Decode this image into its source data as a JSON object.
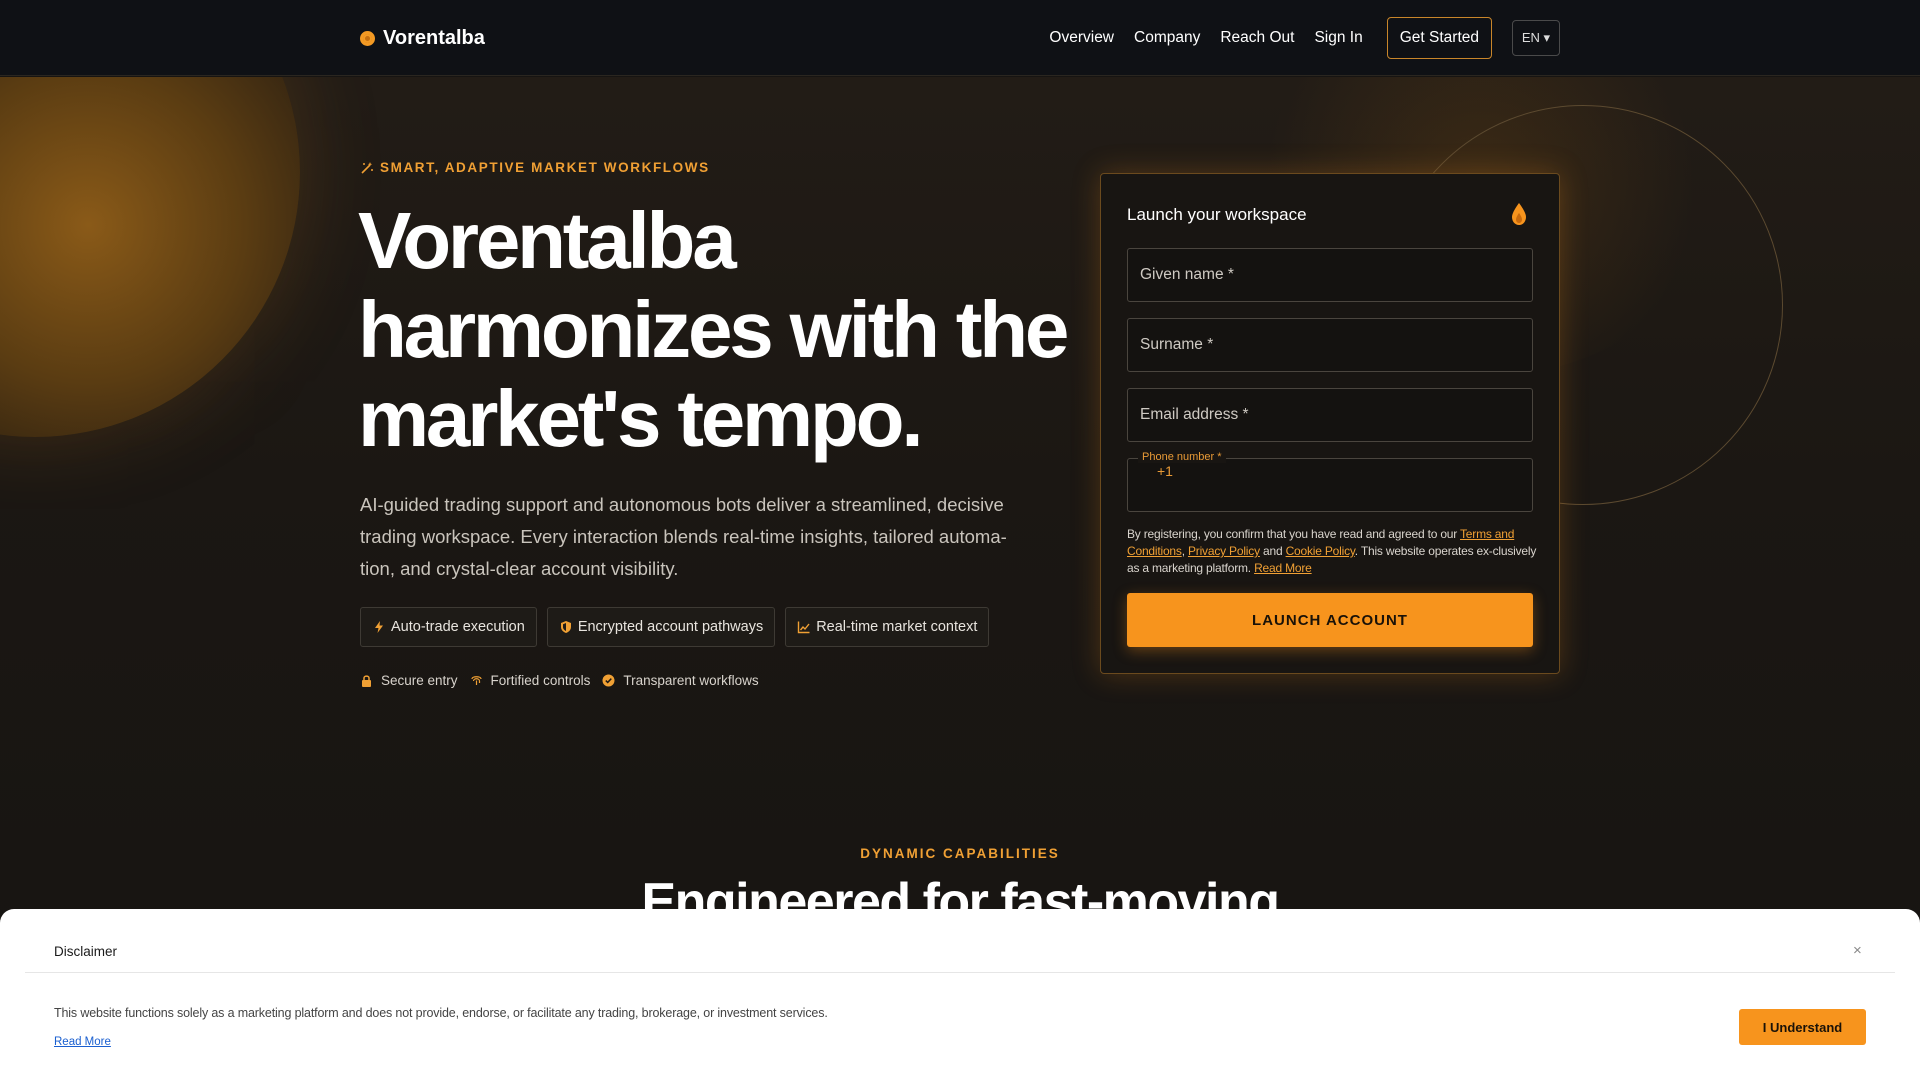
{
  "header": {
    "brand": "Vorentalba",
    "nav": [
      "Overview",
      "Company",
      "Reach Out",
      "Sign In"
    ],
    "cta": "Get Started",
    "lang": "EN ▾"
  },
  "hero": {
    "eyebrow": "SMART, ADAPTIVE MARKET WORKFLOWS",
    "title_line1": "Vorentalba",
    "title_line2": "harmonizes with the",
    "title_line3": "market's tempo.",
    "subtitle": "AI-guided trading support and autonomous bots deliver a streamlined, decisive trading workspace. Every interaction blends real-time insights, tailored automa-tion, and crystal-clear account visibility.",
    "chips": [
      "Auto-trade execution",
      "Encrypted account pathways",
      "Real-time market context"
    ],
    "trust": [
      "Secure entry",
      "Fortified controls",
      "Transparent workflows"
    ]
  },
  "form": {
    "title": "Launch your workspace",
    "given_name": "Given name *",
    "surname": "Surname *",
    "email": "Email address *",
    "phone_label": "Phone number *",
    "phone_code": "+1",
    "legal_pre": "By registering, you confirm that you have read and agreed to our ",
    "terms": "Terms and Conditions",
    "privacy": "Privacy Policy",
    "and": " and ",
    "cookie": "Cookie Policy",
    "legal_post": ". This website operates ex-clusively as a marketing platform. ",
    "read_more": "Read More",
    "submit": "LAUNCH ACCOUNT"
  },
  "section": {
    "eyebrow": "DYNAMIC CAPABILITIES",
    "title": "Engineered for fast-moving"
  },
  "disclaimer": {
    "title": "Disclaimer",
    "close": "×",
    "text": "This website functions solely as a marketing platform and does not provide, endorse, or facilitate any trading, brokerage, or investment services.",
    "read_more": "Read More",
    "button": "I Understand"
  },
  "colors": {
    "accent": "#f7941d",
    "background": "#161412",
    "header": "#0f1115"
  }
}
